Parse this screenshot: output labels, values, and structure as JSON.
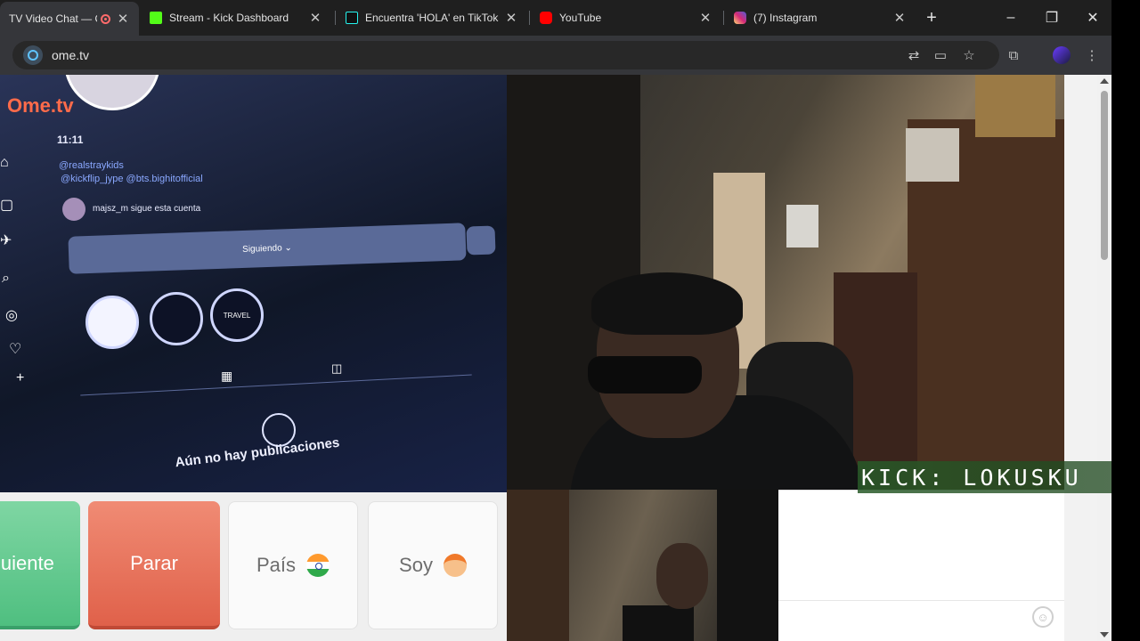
{
  "browser": {
    "tabs": [
      {
        "title": "TV Video Chat — O",
        "recording": true
      },
      {
        "title": "Stream - Kick Dashboard"
      },
      {
        "title": "Encuentra 'HOLA' en TikTok"
      },
      {
        "title": "YouTube"
      },
      {
        "title": "(7) Instagram"
      }
    ],
    "url": "ome.tv",
    "window_controls": {
      "minimize": "–",
      "maximize": "❐",
      "close": "✕"
    }
  },
  "remote_video": {
    "logo": "Ome.tv",
    "ig_time": "11:11",
    "ig_link1": "@realstraykids",
    "ig_link2": "@kickflip_jype @bts.bighitofficial",
    "ig_follower_note": "majsz_m sigue esta cuenta",
    "ig_following_button": "Siguiendo ⌄",
    "ig_story3": "TRAVEL",
    "ig_empty_text": "Aún no hay publicaciones"
  },
  "stream_overlay": {
    "text": "KICK: LOKUSKU"
  },
  "actions": {
    "next": "Siguiente",
    "stop": "Parar",
    "country": "País",
    "gender": "Soy"
  },
  "colors": {
    "next": "#5ec98b",
    "stop": "#e8694f",
    "overlay": "#2f6b2f"
  }
}
